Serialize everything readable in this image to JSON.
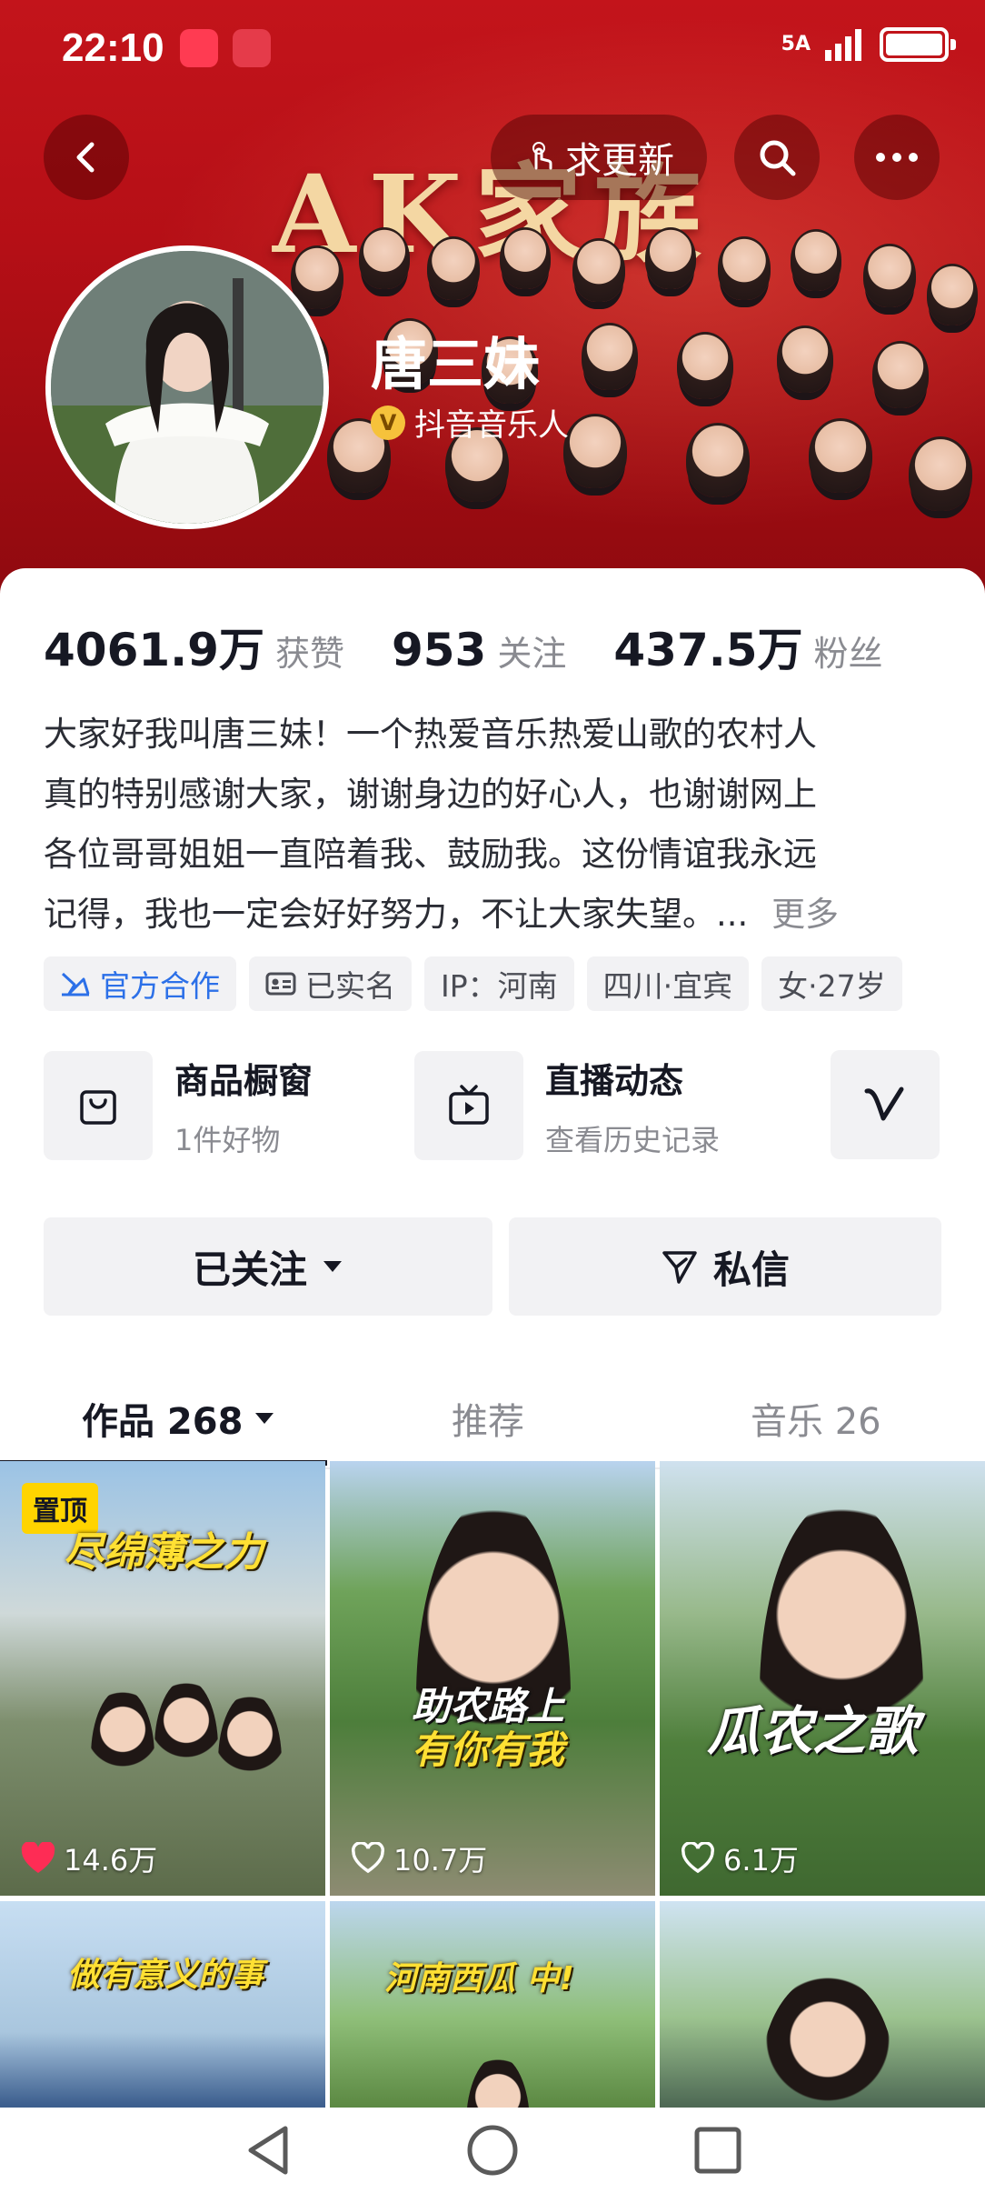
{
  "status_bar": {
    "time": "22:10",
    "network": "5A",
    "app_icons": [
      "app-gallery-icon",
      "book-icon"
    ]
  },
  "header": {
    "banner_title": "AK家族",
    "update_label": "求更新",
    "profile_name": "唐三妹",
    "verify_label": "抖音音乐人",
    "verify_badge": "V"
  },
  "stats": [
    {
      "value": "4061.9万",
      "label": "获赞"
    },
    {
      "value": "953",
      "label": "关注"
    },
    {
      "value": "437.5万",
      "label": "粉丝"
    }
  ],
  "bio": {
    "lines": [
      "大家好我叫唐三妹！一个热爱音乐热爱山歌的农村人",
      "真的特别感谢大家，谢谢身边的好心人，也谢谢网上",
      "各位哥哥姐姐一直陪着我、鼓励我。这份情谊我永远",
      "记得，我也一定会好好努力，不让大家失望。..."
    ],
    "more": "更多"
  },
  "tags": [
    {
      "label": "官方合作",
      "icon": "official-icon"
    },
    {
      "label": "已实名",
      "icon": "id-card-icon"
    },
    {
      "label": "IP：河南"
    },
    {
      "label": "四川·宜宾"
    },
    {
      "label": "女·27岁"
    }
  ],
  "features": {
    "store_title": "商品橱窗",
    "store_sub": "1件好物",
    "live_title": "直播动态",
    "live_sub": "查看历史记录"
  },
  "actions": {
    "followed": "已关注",
    "message": "私信"
  },
  "tabs": {
    "works": "作品 268",
    "recommend": "推荐",
    "music": "音乐 26"
  },
  "videos": [
    {
      "pinned": "置顶",
      "caption": "尽绵薄之力",
      "likes": "14.6万",
      "liked": true
    },
    {
      "caption_line1": "助农路上",
      "caption_line2": "有你有我",
      "likes": "10.7万"
    },
    {
      "caption": "瓜农之歌",
      "likes": "6.1万"
    },
    {
      "caption": "做有意义的事"
    },
    {
      "caption": "河南西瓜 中!"
    },
    {
      "caption": ""
    }
  ],
  "colors": {
    "banner_red": "#b50f16",
    "official_blue": "#2c70e8",
    "pin_yellow": "#ffd400",
    "like_red": "#fe2c55"
  }
}
